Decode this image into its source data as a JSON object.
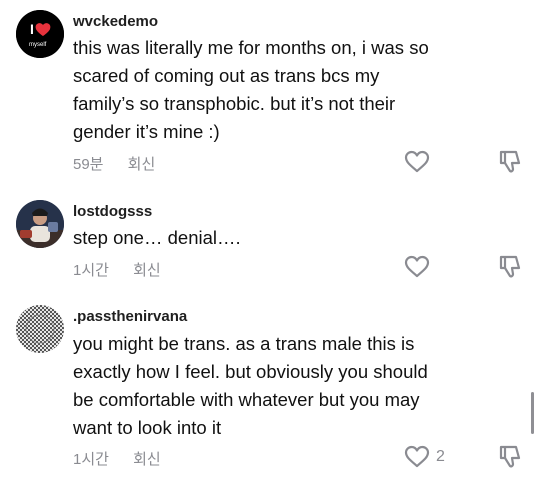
{
  "comments": [
    {
      "username": "wvckedemo",
      "avatar": {
        "heart_text": "I",
        "caption": "myself",
        "colors": {
          "bg": "#000000",
          "heart": "#e8323c"
        }
      },
      "text": "this was literally me for months on, i was so\nscared of coming out as trans bcs my\nfamily’s so transphobic. but it’s not their\ngender it’s mine :)",
      "time": "59분",
      "reply_label": "회신",
      "like_count": ""
    },
    {
      "username": "lostdogsss",
      "avatar": {
        "description_icon": "photo-avatar"
      },
      "text": "step one… denial….",
      "time": "1시간",
      "reply_label": "회신",
      "like_count": ""
    },
    {
      "username": ".passthenirvana",
      "avatar": {
        "description_icon": "pattern-avatar"
      },
      "text": "you might be trans. as a trans male this is\nexactly how I feel. but obviously you should\nbe comfortable with whatever but you may\nwant to look into it",
      "time": "1시간",
      "reply_label": "회신",
      "like_count": "2"
    }
  ],
  "colors": {
    "text": "#111111",
    "meta": "#8a8b91",
    "icon": "#8a8b91"
  }
}
